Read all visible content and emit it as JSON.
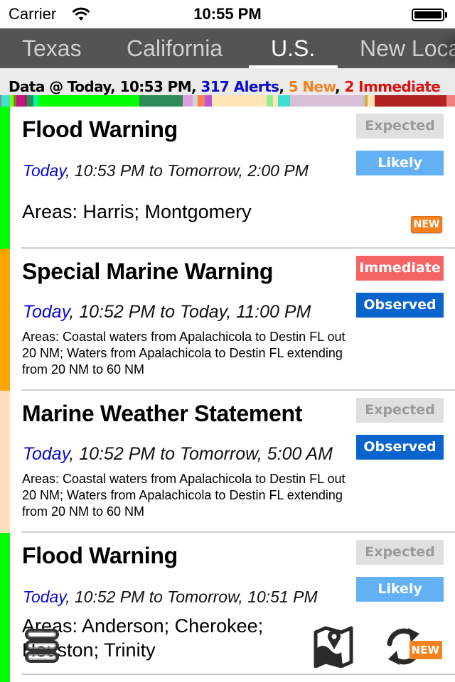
{
  "status_bar": {
    "carrier": "Carrier",
    "time": "10:55 PM",
    "wifi_icon": "wifi-icon",
    "battery_icon": "battery-icon"
  },
  "tabs": [
    {
      "label": "Texas",
      "active": false
    },
    {
      "label": "California",
      "active": false
    },
    {
      "label": "U.S.",
      "active": true
    },
    {
      "label": "New Loca",
      "active": false
    }
  ],
  "info": {
    "prefix": "Data @ Today, 10:53 PM, ",
    "alerts": "317 Alerts",
    "sep1": ", ",
    "new": "5 New",
    "sep2": ", ",
    "immediate": "2 Immediate"
  },
  "colors": {
    "today": "#0a0ad2",
    "expected_bg": "#e0e0e0",
    "expected_fg": "#9a9a9a",
    "likely_bg": "#64b0f5",
    "immediate_bg": "#f56464",
    "observed_bg": "#0a64cd",
    "new_badge": "#f5821f",
    "flood_warning": "#00ff00",
    "special_marine_warning": "#ffa500",
    "marine_weather_statement": "#ffdfbd"
  },
  "colorbar": [
    {
      "color": "#888888",
      "weight": 2
    },
    {
      "color": "#40e0d0",
      "weight": 12
    },
    {
      "color": "#7fff00",
      "weight": 5
    },
    {
      "color": "#6b8e23",
      "weight": 4
    },
    {
      "color": "#c71585",
      "weight": 12
    },
    {
      "color": "#8b0000",
      "weight": 1
    },
    {
      "color": "#2e8b57",
      "weight": 10
    },
    {
      "color": "#00fa9a",
      "weight": 7
    },
    {
      "color": "#00ff00",
      "weight": 140
    },
    {
      "color": "#2e8b57",
      "weight": 60
    },
    {
      "color": "#dda0dd",
      "weight": 14
    },
    {
      "color": "#d3d3d3",
      "weight": 7
    },
    {
      "color": "#ff7f50",
      "weight": 10
    },
    {
      "color": "#ba55d3",
      "weight": 9
    },
    {
      "color": "#ffe4b5",
      "weight": 76
    },
    {
      "color": "#90ee90",
      "weight": 9
    },
    {
      "color": "#ffe4b5",
      "weight": 7
    },
    {
      "color": "#40e0d0",
      "weight": 17
    },
    {
      "color": "#d8bfd8",
      "weight": 100
    },
    {
      "color": "#c0c0c0",
      "weight": 4
    },
    {
      "color": "#daa520",
      "weight": 3
    },
    {
      "color": "#ffe4b5",
      "weight": 10
    },
    {
      "color": "#b22222",
      "weight": 99
    },
    {
      "color": "#f08080",
      "weight": 12
    }
  ],
  "alerts": [
    {
      "title": "Flood Warning",
      "severity_color": "#00ff00",
      "time_today": "Today",
      "time_rest": ", 10:53 PM to Tomorrow, 2:00 PM",
      "areas": "Areas: Harris; Montgomery",
      "urgency": "Expected",
      "certainty": "Likely",
      "is_new": true,
      "new_label": "NEW"
    },
    {
      "title": "Special Marine Warning",
      "severity_color": "#ffa500",
      "time_today": "Today",
      "time_rest": ", 10:52 PM to Today, 11:00 PM",
      "areas": "Areas: Coastal waters from Apalachicola to Destin FL out 20 NM; Waters from Apalachicola to Destin FL extending from 20 NM to 60 NM",
      "urgency": "Immediate",
      "certainty": "Observed",
      "is_new": false
    },
    {
      "title": "Marine Weather Statement",
      "severity_color": "#ffdfbd",
      "time_today": "Today",
      "time_rest": ", 10:52 PM to Tomorrow, 5:00 AM",
      "areas": "Areas: Coastal waters from Apalachicola to Destin FL out 20 NM; Waters from Apalachicola to Destin FL extending from 20 NM to 60 NM",
      "urgency": "Expected",
      "certainty": "Observed",
      "is_new": false
    },
    {
      "title": "Flood Warning",
      "severity_color": "#00ff00",
      "time_today": "Today",
      "time_rest": ", 10:52 PM to Tomorrow, 10:51 PM",
      "areas_line1": "Areas: Anderson; Cherokee;",
      "areas_line2": "Houston; Trinity",
      "urgency": "Expected",
      "certainty": "Likely",
      "is_new": true
    }
  ],
  "toolbar": {
    "menu_icon": "menu-list-icon",
    "map_icon": "map-pin-icon",
    "refresh_icon": "refresh-icon",
    "refresh_new_label": "NEW"
  }
}
